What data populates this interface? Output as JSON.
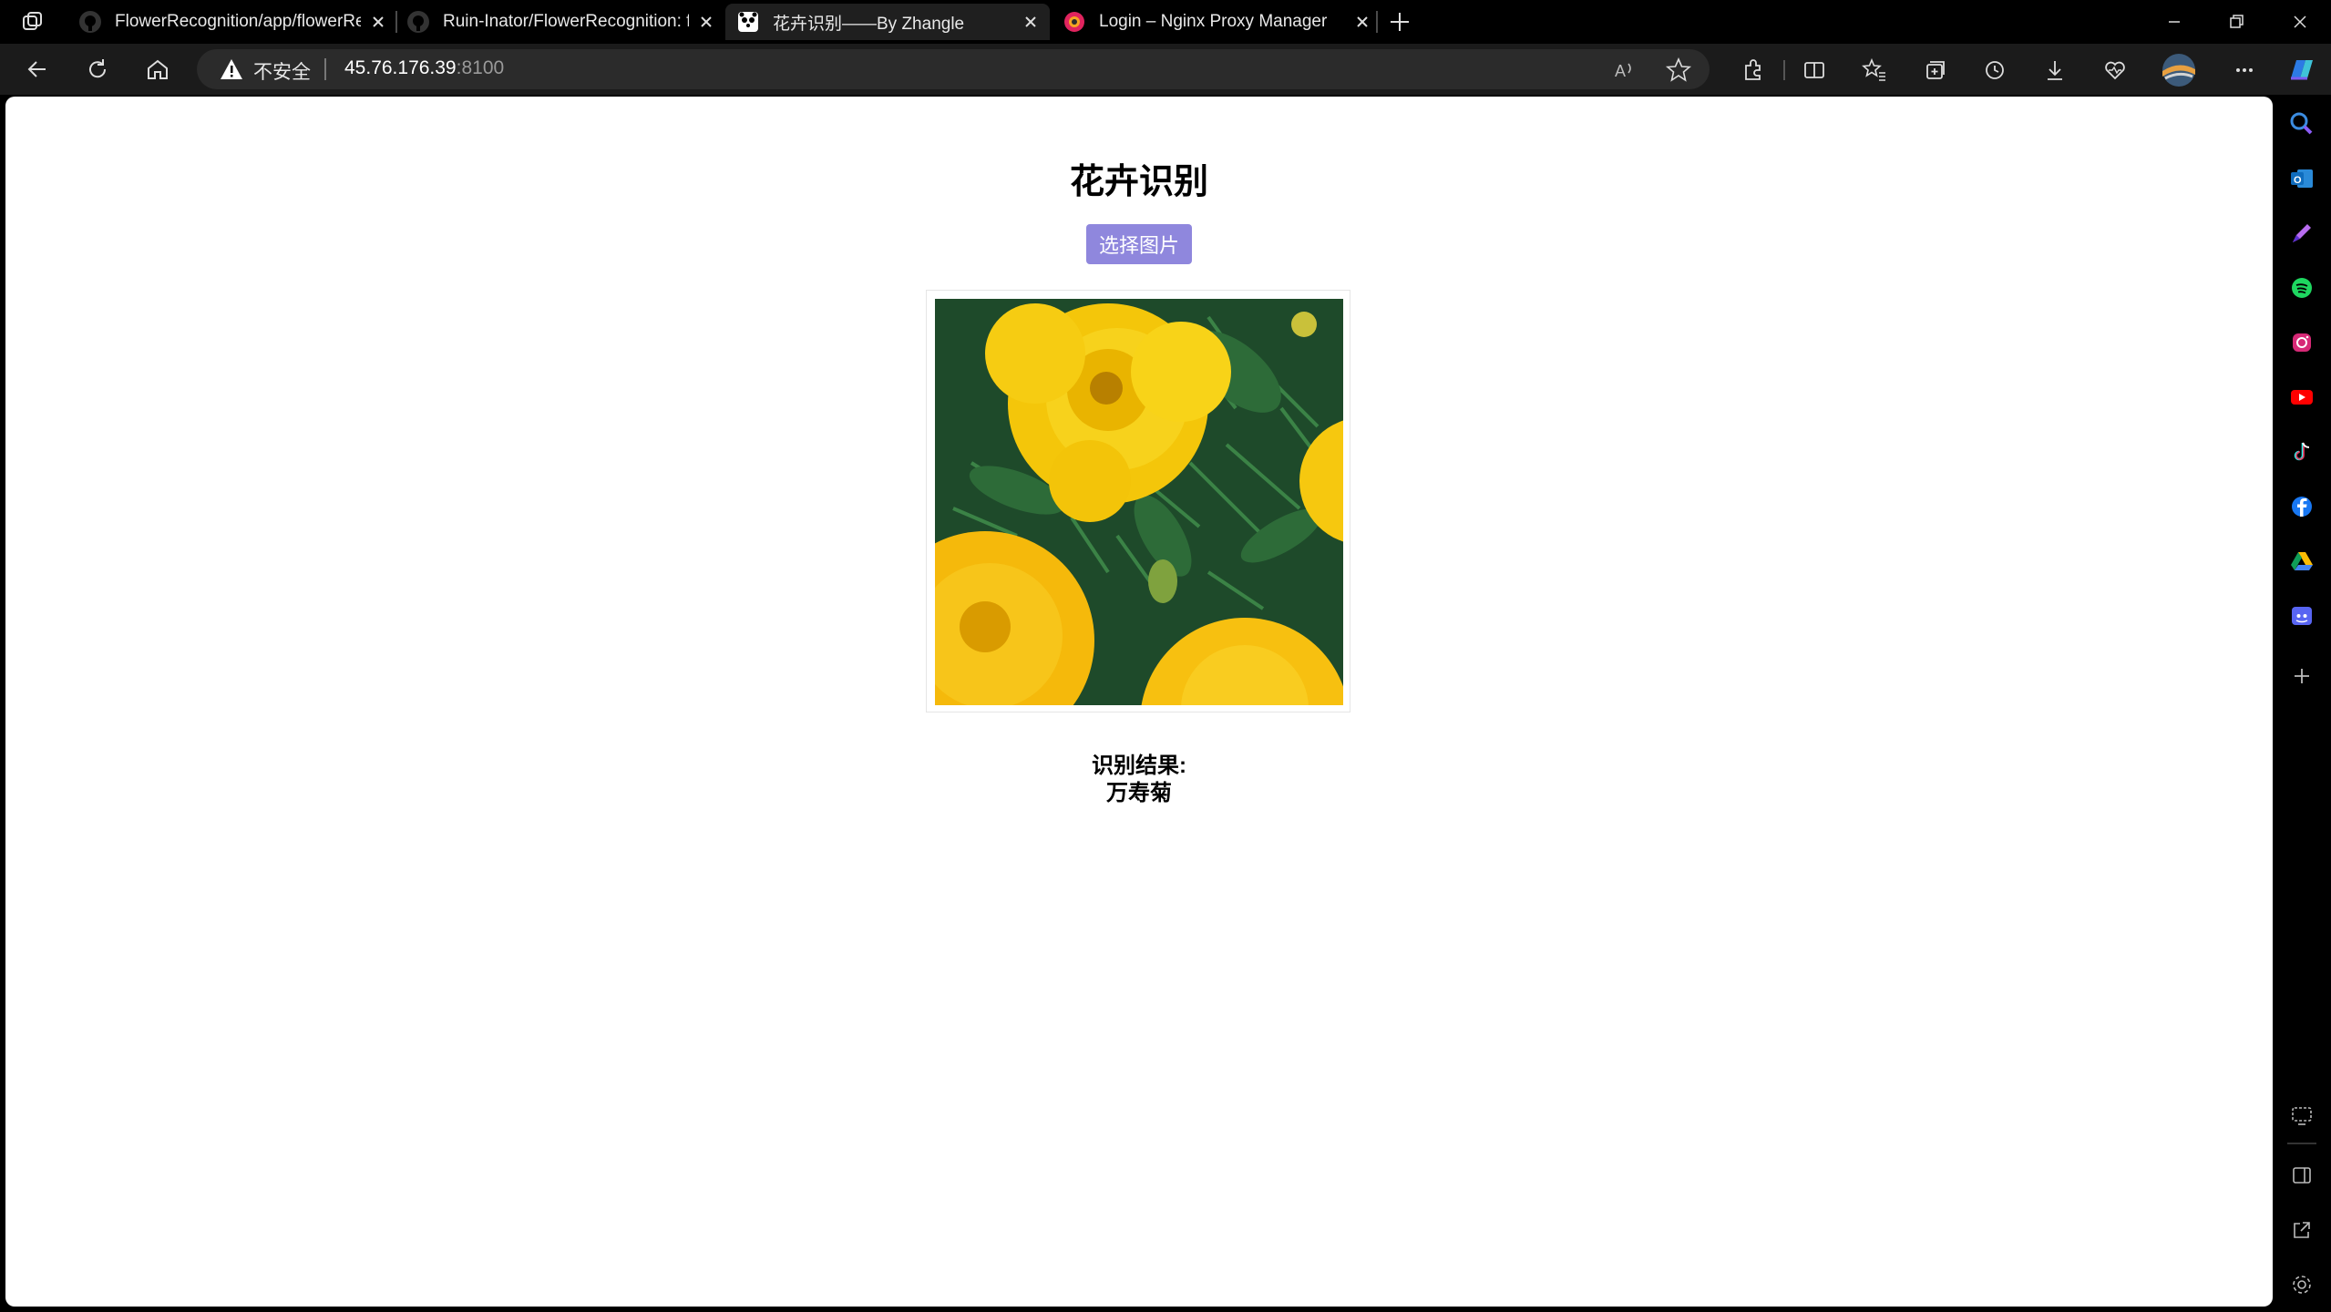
{
  "browser": {
    "tabs": [
      {
        "title": "FlowerRecognition/app/flowerRe",
        "favicon": "github-icon",
        "active": false
      },
      {
        "title": "Ruin-Inator/FlowerRecognition: f",
        "favicon": "github-icon",
        "active": false
      },
      {
        "title": "花卉识别——By Zhangle",
        "favicon": "panda-icon",
        "active": true
      },
      {
        "title": "Login – Nginx Proxy Manager",
        "favicon": "nginx-proxy-manager-icon",
        "active": false
      }
    ],
    "address": {
      "security_label": "不安全",
      "host": "45.76.176.39",
      "port": ":8100"
    }
  },
  "page": {
    "heading": "花卉识别",
    "choose_button": "选择图片",
    "image": {
      "subject": "marigold flowers photo"
    },
    "result_label": "识别结果:",
    "result_value": "万寿菊",
    "accent_color": "#8f87dd"
  },
  "sidebar": {
    "icons": [
      "search-icon",
      "outlook-icon",
      "copilot-pen-icon",
      "spotify-icon",
      "instagram-icon",
      "youtube-icon",
      "tiktok-icon",
      "facebook-icon",
      "google-drive-icon",
      "discord-icon",
      "add-icon",
      "screenshot-icon",
      "sidebar-toggle-icon",
      "open-external-icon",
      "settings-icon"
    ]
  }
}
